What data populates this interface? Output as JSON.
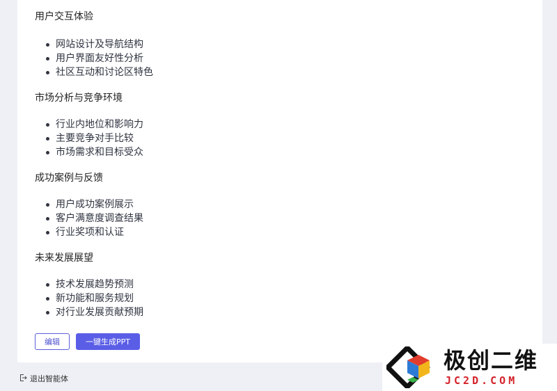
{
  "sections": [
    {
      "title": "用户交互体验",
      "items": [
        "网站设计及导航结构",
        "用户界面友好性分析",
        "社区互动和讨论区特色"
      ]
    },
    {
      "title": "市场分析与竞争环境",
      "items": [
        "行业内地位和影响力",
        "主要竞争对手比较",
        "市场需求和目标受众"
      ]
    },
    {
      "title": "成功案例与反馈",
      "items": [
        "用户成功案例展示",
        "客户满意度调查结果",
        "行业奖项和认证"
      ]
    },
    {
      "title": "未来发展展望",
      "items": [
        "技术发展趋势预测",
        "新功能和服务规划",
        "对行业发展贡献预期"
      ]
    }
  ],
  "actions": {
    "edit_label": "编辑",
    "generate_label": "一键生成PPT"
  },
  "footer": {
    "exit_label": "退出智能体",
    "exit_icon": "logout-icon"
  },
  "watermark": {
    "title": "极创二维",
    "subtitle": "JC2D.COM"
  },
  "colors": {
    "accent": "#5a5ee6",
    "watermark_red": "#d4232b"
  }
}
